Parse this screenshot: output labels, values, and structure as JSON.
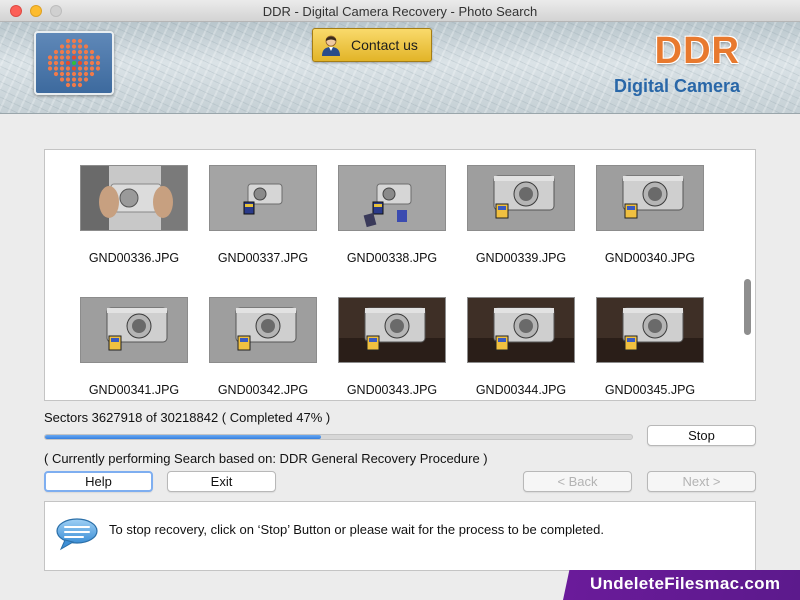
{
  "window": {
    "title": "DDR - Digital Camera Recovery - Photo Search"
  },
  "header": {
    "contact_label": "Contact us",
    "brand": "DDR",
    "sub_brand": "Digital Camera"
  },
  "files": [
    {
      "name": "GND00336.JPG",
      "scene": "hands-camera"
    },
    {
      "name": "GND00337.JPG",
      "scene": "small-camera"
    },
    {
      "name": "GND00338.JPG",
      "scene": "small-camera-cards"
    },
    {
      "name": "GND00339.JPG",
      "scene": "camera-gray"
    },
    {
      "name": "GND00340.JPG",
      "scene": "camera-gray"
    },
    {
      "name": "GND00341.JPG",
      "scene": "camera-gray"
    },
    {
      "name": "GND00342.JPG",
      "scene": "camera-gray"
    },
    {
      "name": "GND00343.JPG",
      "scene": "camera-dark"
    },
    {
      "name": "GND00344.JPG",
      "scene": "camera-dark"
    },
    {
      "name": "GND00345.JPG",
      "scene": "camera-dark"
    }
  ],
  "status": {
    "sectors_text": "Sectors 3627918 of 30218842   ( Completed 47% )",
    "progress_percent": 47,
    "performing_text": "( Currently performing Search based on: DDR General Recovery Procedure )"
  },
  "buttons": {
    "stop": "Stop",
    "help": "Help",
    "exit": "Exit",
    "back": "< Back",
    "next": "Next >"
  },
  "message": {
    "text": "To stop recovery, click on ‘Stop’ Button or please wait for the process to be completed."
  },
  "watermark": "UndeleteFilesmac.com",
  "colors": {
    "brand_orange": "#e8792e",
    "brand_blue": "#2967a8",
    "progress_blue": "#3680e0",
    "watermark_purple": "#6a1b9a"
  }
}
